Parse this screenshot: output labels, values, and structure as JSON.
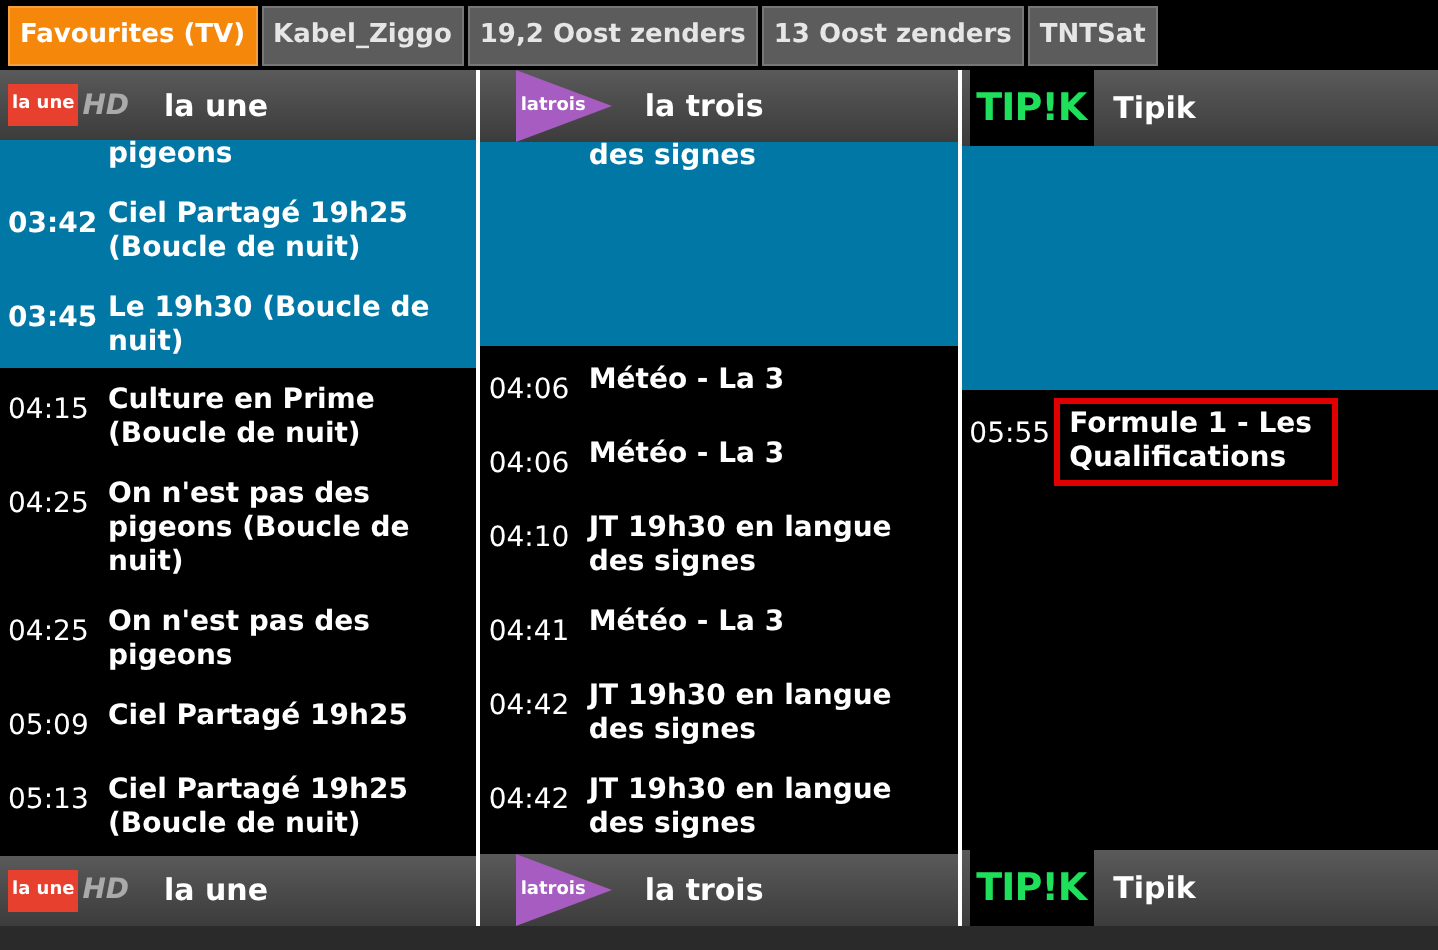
{
  "tabs": [
    {
      "label": "Favourites (TV)",
      "selected": true
    },
    {
      "label": "Kabel_Ziggo",
      "selected": false
    },
    {
      "label": "19,2 Oost zenders",
      "selected": false
    },
    {
      "label": "13 Oost zenders",
      "selected": false
    },
    {
      "label": "TNTSat",
      "selected": false
    }
  ],
  "channels": [
    {
      "header": {
        "name": "la une",
        "logo": {
          "kind": "laune",
          "parts": [
            "la une",
            "HD"
          ]
        }
      },
      "programs": [
        {
          "title": "pigeons",
          "past": true,
          "selected": false
        },
        {
          "time": "03:42",
          "title": "Ciel Partagé 19h25 (Boucle de nuit)",
          "past": true,
          "selected": false
        },
        {
          "time": "03:45",
          "title": "Le 19h30 (Boucle de nuit)",
          "past": true,
          "selected": false
        },
        {
          "time": "04:15",
          "title": "Culture en Prime (Boucle de nuit)",
          "past": false,
          "selected": false
        },
        {
          "time": "04:25",
          "title": "On n'est pas des pigeons (Boucle de nuit)",
          "past": false,
          "selected": false
        },
        {
          "time": "04:25",
          "title": "On n'est pas des pigeons",
          "past": false,
          "selected": false
        },
        {
          "time": "05:09",
          "title": "Ciel Partagé 19h25",
          "past": false,
          "selected": false
        },
        {
          "time": "05:13",
          "title": "Ciel Partagé 19h25 (Boucle de nuit)",
          "past": false,
          "selected": false
        }
      ],
      "footer": {
        "name": "la une",
        "logo": {
          "kind": "laune",
          "parts": [
            "la une",
            "HD"
          ]
        }
      }
    },
    {
      "header": {
        "name": "la trois",
        "logo": {
          "kind": "latrois",
          "parts": [
            "latrois"
          ]
        }
      },
      "programs": [
        {
          "title": "des signes",
          "past": true,
          "selected": false
        },
        {
          "time": "04:06",
          "title": "Météo - La 3",
          "past": false,
          "selected": false
        },
        {
          "time": "04:06",
          "title": "Météo - La 3",
          "past": false,
          "selected": false
        },
        {
          "time": "04:10",
          "title": "JT 19h30 en langue des signes",
          "past": false,
          "selected": false
        },
        {
          "time": "04:41",
          "title": "Météo - La 3",
          "past": false,
          "selected": false
        },
        {
          "time": "04:42",
          "title": "JT 19h30 en langue des signes",
          "past": false,
          "selected": false
        },
        {
          "time": "04:42",
          "title": "JT 19h30 en langue des signes",
          "past": false,
          "selected": false
        }
      ],
      "footer": {
        "name": "la trois",
        "logo": {
          "kind": "latrois",
          "parts": [
            "latrois"
          ]
        }
      }
    },
    {
      "header": {
        "name": "Tipik",
        "logo": {
          "kind": "tipik",
          "parts": [
            "TIP!K"
          ]
        }
      },
      "programs": [
        {
          "time": "05:55",
          "title": "Formule 1 - Les Qualifications",
          "past": false,
          "selected": true
        }
      ],
      "footer": {
        "name": "Tipik",
        "logo": {
          "kind": "tipik",
          "parts": [
            "TIP!K"
          ]
        }
      }
    }
  ]
}
